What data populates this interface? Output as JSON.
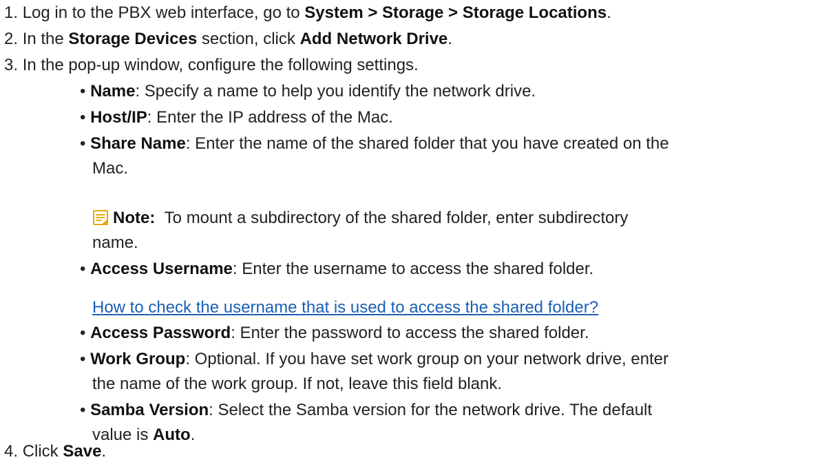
{
  "steps": [
    {
      "num": "1.",
      "parts": [
        "Log in to the PBX web interface, go to ",
        "System > Storage > Storage Locations",
        "."
      ]
    },
    {
      "num": "2.",
      "parts": [
        "In the ",
        "Storage Devices",
        " section, click ",
        "Add Network Drive",
        "."
      ]
    },
    {
      "num": "3.",
      "parts": [
        "In the pop-up window, configure the following settings."
      ]
    },
    {
      "num": "4.",
      "parts": [
        "Click ",
        "Save",
        "."
      ]
    }
  ],
  "settings": {
    "name": {
      "label": "Name",
      "desc": ": Specify a name to help you identify the network drive."
    },
    "host": {
      "label": "Host/IP",
      "desc": ": Enter the IP address of the Mac."
    },
    "share": {
      "label": "Share Name",
      "desc_line1": ": Enter the name of the shared folder that you have created on the",
      "desc_line2": "Mac."
    },
    "note": {
      "icon": "note-icon",
      "label": "Note:",
      "text_line1": "To mount a subdirectory of the shared folder, enter subdirectory",
      "text_line2": "name."
    },
    "username": {
      "label": "Access Username",
      "desc": ": Enter the username to access the shared folder.",
      "link": "How to check the username that is used to access the shared folder?"
    },
    "password": {
      "label": "Access Password",
      "desc": ": Enter the password to access the shared folder."
    },
    "workgroup": {
      "label": "Work Group",
      "desc_line1": ": Optional. If you have set work group on your network drive, enter",
      "desc_line2": "the name of the work group. If not, leave this field blank."
    },
    "samba": {
      "label": "Samba Version",
      "desc_line1": ": Select the Samba version for the network drive. The default",
      "desc_line2_prefix": "value is ",
      "default_value": "Auto",
      "desc_line2_suffix": "."
    }
  },
  "bullet_char": "•",
  "colors": {
    "link": "#1a5fb4",
    "note_icon": "#e8a90c"
  }
}
